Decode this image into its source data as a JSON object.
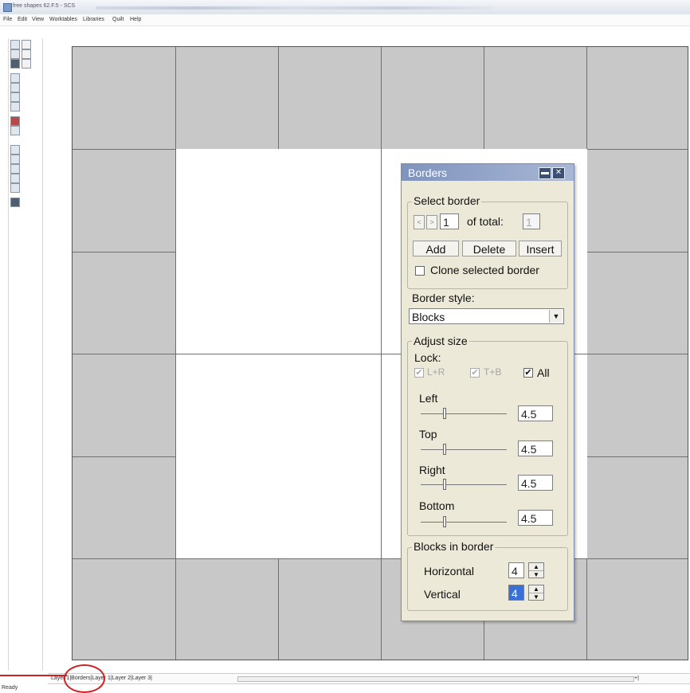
{
  "app": {
    "title": "free shapes 62.F.5 - SCS",
    "menu": [
      "File",
      "Edit",
      "View",
      "Worktables",
      "Libraries",
      "Quilt",
      "Help"
    ]
  },
  "statusbar": {
    "tabs_text": "Layer 1|Borders|Layer 1|Layer 2|Layer 3|",
    "scroll_marker": "+|",
    "ready": "Ready"
  },
  "dialog": {
    "title": "Borders",
    "select_border": {
      "label": "Select border",
      "current": "1",
      "of_total_label": "of total:",
      "total": "1",
      "prev": "<",
      "next": ">",
      "add": "Add",
      "delete": "Delete",
      "insert": "Insert",
      "clone_label": "Clone selected border"
    },
    "border_style": {
      "label": "Border style:",
      "value": "Blocks"
    },
    "adjust_size": {
      "label": "Adjust size",
      "lock_label": "Lock:",
      "lock_lr": "L+R",
      "lock_tb": "T+B",
      "lock_all": "All",
      "left_label": "Left",
      "left_value": "4.5",
      "top_label": "Top",
      "top_value": "4.5",
      "right_label": "Right",
      "right_value": "4.5",
      "bottom_label": "Bottom",
      "bottom_value": "4.5"
    },
    "blocks_in_border": {
      "label": "Blocks in border",
      "horizontal_label": "Horizontal",
      "horizontal_value": "4",
      "vertical_label": "Vertical",
      "vertical_value": "4"
    }
  },
  "colors": {
    "dialog_title": "#8a9cc4",
    "dialog_bg": "#ece9d8",
    "quilt_block": "#c8c8c8",
    "annotation": "#cc2222"
  }
}
